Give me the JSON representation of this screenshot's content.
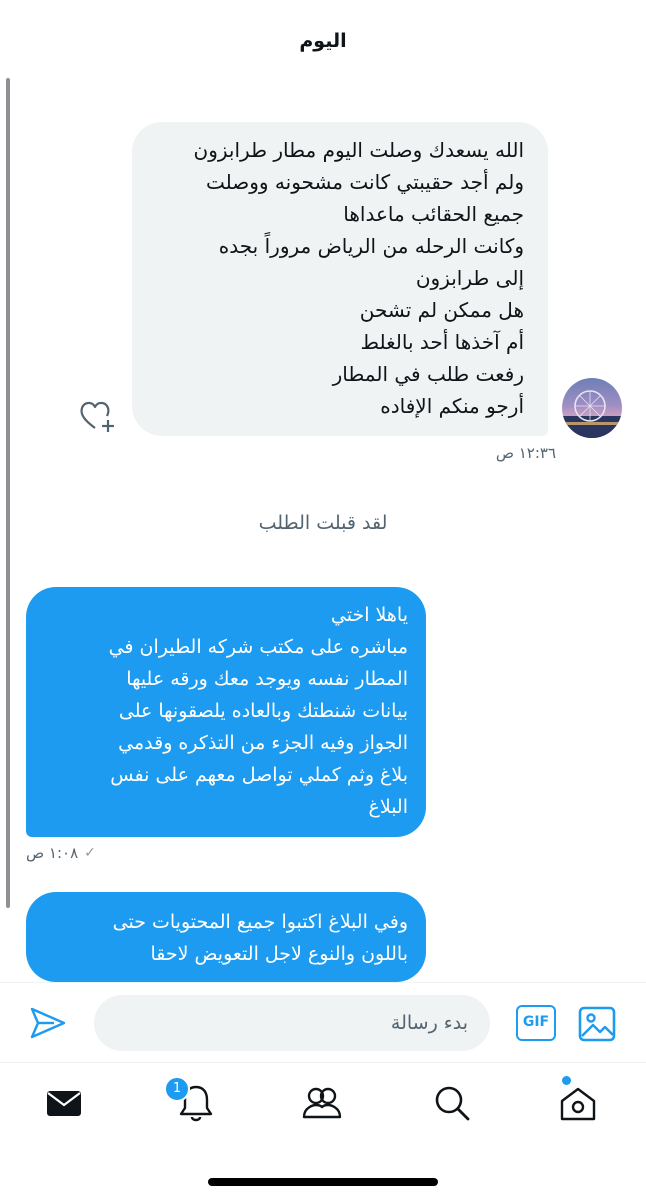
{
  "header": {
    "day_label": "اليوم"
  },
  "messages": {
    "incoming": {
      "lines": [
        "الله يسعدك وصلت اليوم مطار طرابزون",
        "ولم أجد حقيبتي كانت مشحونه ووصلت",
        "جميع الحقائب ماعداها",
        "وكانت الرحله من الرياض مروراً بجده",
        "إلى طرابزون",
        "هل ممكن لم تشحن",
        "أم آخذها أحد بالغلط",
        "رفعت طلب في المطار",
        "أرجو منكم الإفاده"
      ],
      "time": "١٢:٣٦ ص"
    },
    "system_notice": "لقد قبلت الطلب",
    "outgoing_1": {
      "lines": [
        "ياهلا اختي",
        "مباشره على مكتب شركه الطيران في",
        "المطار نفسه ويوجد معك ورقه عليها",
        "بيانات شنطتك وبالعاده يلصقونها على",
        "الجواز وفيه الجزء من التذكره وقدمي",
        "بلاغ وثم كملي تواصل معهم على نفس",
        "البلاغ"
      ],
      "time": "١:٠٨ ص",
      "status": "✓"
    },
    "outgoing_2": {
      "lines": [
        "وفي البلاغ اكتبوا جميع المحتويات حتى",
        "باللون والنوع لاجل التعويض لاحقا"
      ]
    }
  },
  "composer": {
    "placeholder": "بدء رسالة",
    "gif_label": "GIF",
    "send_icon": "send-icon",
    "image_icon": "image-icon"
  },
  "tabbar": {
    "items": [
      "home-icon",
      "search-icon",
      "communities-icon",
      "notifications-icon",
      "messages-icon"
    ],
    "notification_count": "1"
  },
  "colors": {
    "accent": "#1d9bf0",
    "bubble_in": "#eff3f4",
    "muted": "#536471"
  }
}
